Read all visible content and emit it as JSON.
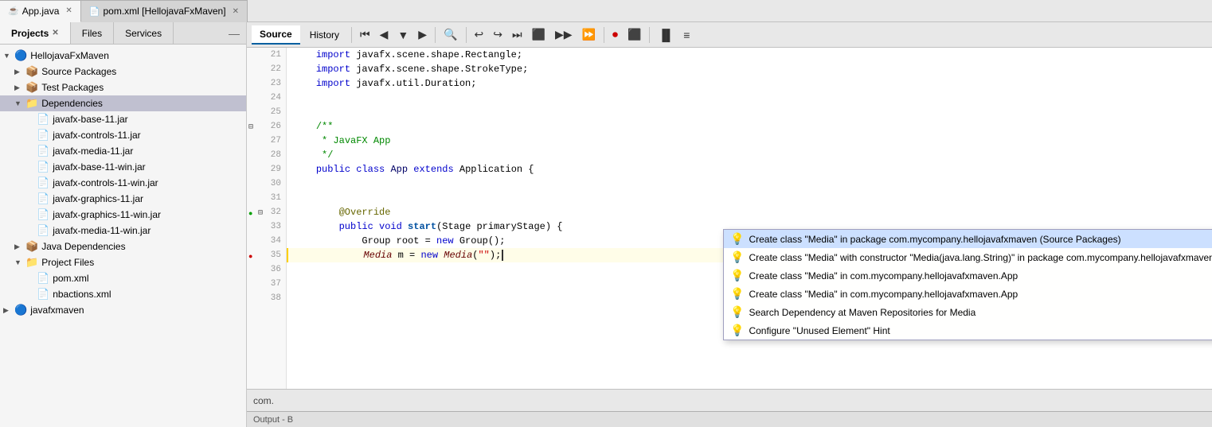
{
  "top_tabs": {
    "tabs": [
      {
        "label": "App.java",
        "icon": "☕",
        "active": true,
        "closable": true
      },
      {
        "label": "pom.xml [HellojavaFxMaven]",
        "icon": "📄",
        "active": false,
        "closable": true
      }
    ]
  },
  "left_panel": {
    "tabs": [
      {
        "label": "Projects",
        "active": true,
        "closable": true
      },
      {
        "label": "Files",
        "active": false
      },
      {
        "label": "Services",
        "active": false
      }
    ],
    "tree": [
      {
        "indent": 0,
        "arrow": "▼",
        "icon": "🔵",
        "label": "HellojavaFxMaven"
      },
      {
        "indent": 1,
        "arrow": "▶",
        "icon": "📦",
        "label": "Source Packages"
      },
      {
        "indent": 1,
        "arrow": "▶",
        "icon": "📦",
        "label": "Test Packages"
      },
      {
        "indent": 1,
        "arrow": "▼",
        "icon": "📁",
        "label": "Dependencies",
        "highlighted": true
      },
      {
        "indent": 2,
        "arrow": "",
        "icon": "📄",
        "label": "javafx-base-11.jar"
      },
      {
        "indent": 2,
        "arrow": "",
        "icon": "📄",
        "label": "javafx-controls-11.jar"
      },
      {
        "indent": 2,
        "arrow": "",
        "icon": "📄",
        "label": "javafx-media-11.jar"
      },
      {
        "indent": 2,
        "arrow": "",
        "icon": "📄",
        "label": "javafx-base-11-win.jar"
      },
      {
        "indent": 2,
        "arrow": "",
        "icon": "📄",
        "label": "javafx-controls-11-win.jar"
      },
      {
        "indent": 2,
        "arrow": "",
        "icon": "📄",
        "label": "javafx-graphics-11.jar"
      },
      {
        "indent": 2,
        "arrow": "",
        "icon": "📄",
        "label": "javafx-graphics-11-win.jar"
      },
      {
        "indent": 2,
        "arrow": "",
        "icon": "📄",
        "label": "javafx-media-11-win.jar"
      },
      {
        "indent": 1,
        "arrow": "▶",
        "icon": "📦",
        "label": "Java Dependencies"
      },
      {
        "indent": 1,
        "arrow": "▼",
        "icon": "📁",
        "label": "Project Files"
      },
      {
        "indent": 2,
        "arrow": "",
        "icon": "📄",
        "label": "pom.xml"
      },
      {
        "indent": 2,
        "arrow": "",
        "icon": "📄",
        "label": "nbactions.xml"
      },
      {
        "indent": 0,
        "arrow": "▶",
        "icon": "🔵",
        "label": "javafxmaven"
      }
    ]
  },
  "editor": {
    "source_tab": "Source",
    "history_tab": "History",
    "lines": [
      {
        "num": 21,
        "code": "    import javafx.scene.shape.Rectangle;",
        "type": "import"
      },
      {
        "num": 22,
        "code": "    import javafx.scene.shape.StrokeType;",
        "type": "import"
      },
      {
        "num": 23,
        "code": "    import javafx.util.Duration;",
        "type": "import"
      },
      {
        "num": 24,
        "code": "",
        "type": "normal"
      },
      {
        "num": 25,
        "code": "",
        "type": "normal"
      },
      {
        "num": 26,
        "code": "    /**",
        "type": "comment",
        "fold": true
      },
      {
        "num": 27,
        "code": "     * JavaFX App",
        "type": "comment"
      },
      {
        "num": 28,
        "code": "     */",
        "type": "comment"
      },
      {
        "num": 29,
        "code": "    public class App extends Application {",
        "type": "code"
      },
      {
        "num": 30,
        "code": "",
        "type": "normal"
      },
      {
        "num": 31,
        "code": "",
        "type": "normal"
      },
      {
        "num": 32,
        "code": "        @Override",
        "type": "annotation",
        "fold": true,
        "dot": "green"
      },
      {
        "num": 33,
        "code": "        public void start(Stage primaryStage) {",
        "type": "code"
      },
      {
        "num": 34,
        "code": "            Group root = new Group();",
        "type": "code"
      },
      {
        "num": 35,
        "code": "            Media m = new Media(\"\");",
        "type": "highlighted",
        "dot": "red"
      },
      {
        "num": 36,
        "code": "",
        "type": "normal"
      },
      {
        "num": 37,
        "code": "",
        "type": "normal"
      },
      {
        "num": 38,
        "code": "",
        "type": "normal"
      }
    ]
  },
  "autocomplete": {
    "items": [
      {
        "label": "Create class \"Media\" in package com.mycompany.hellojavafxmaven (Source Packages)",
        "selected": true
      },
      {
        "label": "Create class \"Media\" with constructor \"Media(java.lang.String)\" in package com.mycompany.hellojavafxmaven (Source Packages)"
      },
      {
        "label": "Create class \"Media\" in com.mycompany.hellojavafxmaven.App"
      },
      {
        "label": "Create class \"Media\" in com.mycompany.hellojavafxmaven.App"
      },
      {
        "label": "Search Dependency at Maven Repositories for Media"
      },
      {
        "label": "Configure \"Unused Element\" Hint"
      }
    ]
  },
  "output_bar": {
    "label": "Output - B"
  },
  "toolbar_buttons": [
    "⏮",
    "◀",
    "▼",
    "▶",
    "🔍",
    "↩",
    "↪",
    "⏭",
    "⬛",
    "▶▶",
    "⏩",
    "⏹",
    "🔴",
    "⬛",
    "▐▌",
    "≡"
  ]
}
